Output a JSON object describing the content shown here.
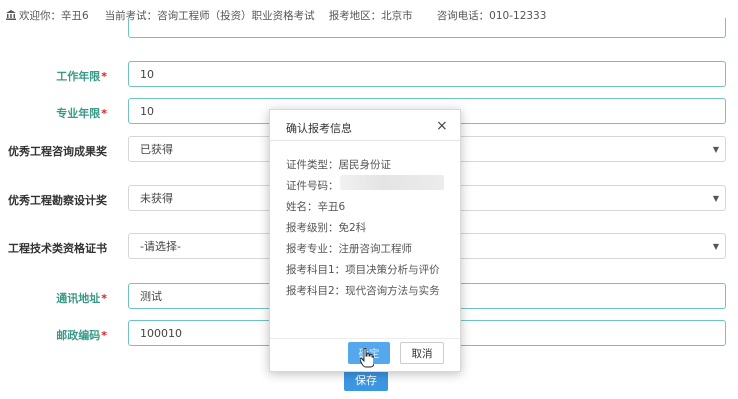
{
  "header": {
    "welcome": "欢迎你：辛丑6",
    "exam": "当前考试：咨询工程师（投资）职业资格考试",
    "region": "报考地区：北京市",
    "phone": "咨询电话：010-12333"
  },
  "form": {
    "work_years_label": "工作年限",
    "work_years_value": "10",
    "major_years_label": "专业年限",
    "major_years_value": "10",
    "award1_label": "优秀工程咨询成果奖",
    "award1_value": "已获得",
    "award2_label": "优秀工程勘察设计奖",
    "award2_value": "未获得",
    "cert_label": "工程技术类资格证书",
    "cert_value": "-请选择-",
    "address_label": "通讯地址",
    "address_value": "测试",
    "postcode_label": "邮政编码",
    "postcode_value": "100010",
    "required_mark": "*",
    "save_label": "保存"
  },
  "modal": {
    "title": "确认报考信息",
    "close": "×",
    "id_type": "证件类型：居民身份证",
    "id_number": "证件号码：",
    "name": "姓名：辛丑6",
    "level": "报考级别：免2科",
    "major": "报考专业：注册咨询工程师",
    "subject1": "报考科目1：项目决策分析与评价",
    "subject2": "报考科目2：现代咨询方法与实务",
    "confirm_label": "确定",
    "cancel_label": "取消"
  },
  "icons": {
    "home": "bank-icon",
    "caret": "caret-down-icon",
    "cursor": "hand-cursor-icon"
  }
}
